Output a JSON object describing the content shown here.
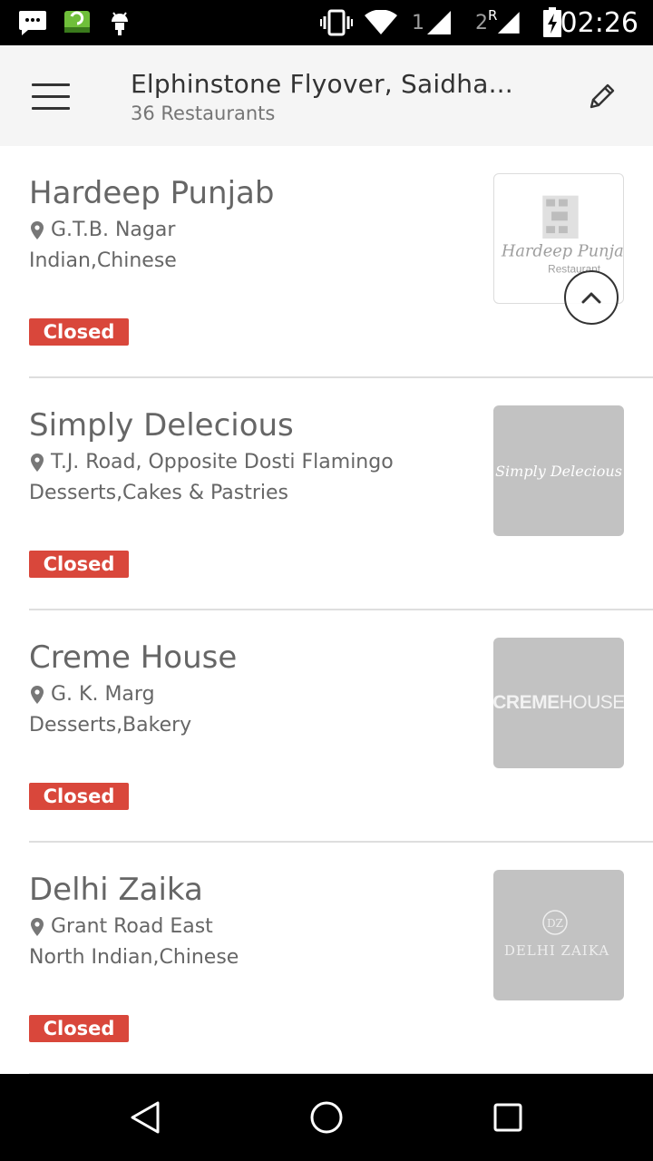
{
  "status_bar": {
    "sim1": "1",
    "sim2": "2",
    "roaming": "R",
    "time": "02:26",
    "icons": [
      "messages-icon",
      "app-notification-icon",
      "android-debug-icon",
      "vibrate-icon",
      "wifi-icon",
      "signal-sim1-icon",
      "signal-sim2-icon",
      "battery-charging-icon"
    ]
  },
  "app_bar": {
    "title": "Elphinstone Flyover, Saidha...",
    "subtitle": "36 Restaurants"
  },
  "restaurants": [
    {
      "name": "Hardeep Punjab",
      "location": "G.T.B. Nagar",
      "cuisine": "Indian,Chinese",
      "status": "Closed",
      "logo_text": "Hardeep Punja",
      "logo_sub": "Restaurant"
    },
    {
      "name": "Simply Delecious",
      "location": "T.J. Road, Opposite Dosti Flamingo",
      "cuisine": "Desserts,Cakes & Pastries",
      "status": "Closed",
      "logo_text": "Simply Delecious"
    },
    {
      "name": "Creme House",
      "location": "G. K. Marg",
      "cuisine": "Desserts,Bakery",
      "status": "Closed",
      "logo_text_bold": "CREME",
      "logo_text_light": "HOUSE"
    },
    {
      "name": "Delhi Zaika",
      "location": "Grant Road East",
      "cuisine": "North Indian,Chinese",
      "status": "Closed",
      "logo_mark": "DZ",
      "logo_text": "DELHI ZAIKA"
    }
  ],
  "colors": {
    "status_closed": "#d9473b",
    "app_bar_bg": "#f5f5f5",
    "text_primary": "#666666"
  }
}
